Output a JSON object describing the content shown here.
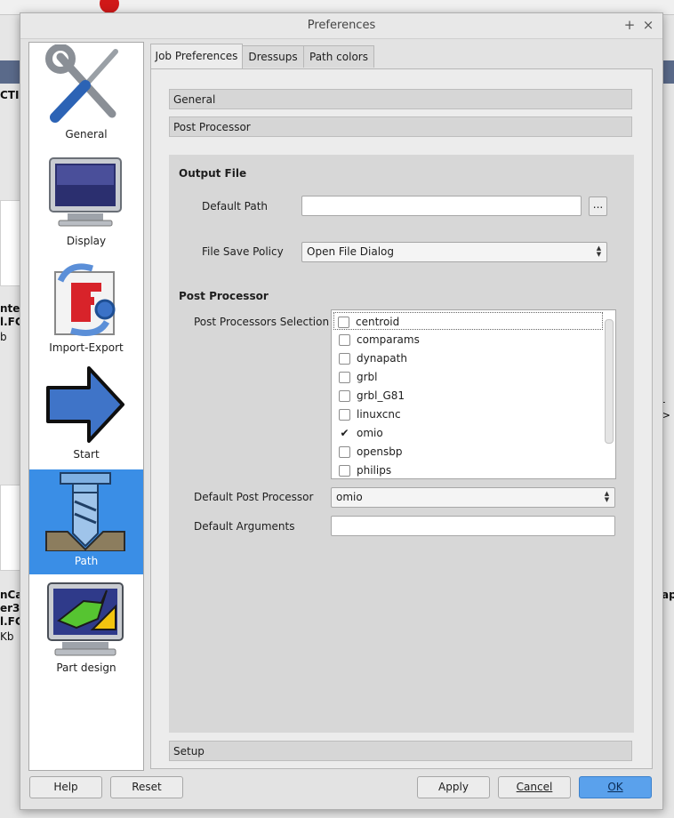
{
  "window": {
    "title": "Preferences",
    "pin_glyph": "+",
    "close_glyph": "×"
  },
  "background": {
    "frag1": "CTI",
    "frag2": "nter",
    "frag3": "l.FC",
    "frag4": "b",
    "frag5": "->",
    "frag6": "nCa",
    "frag7": "er3",
    "frag8": "l.FC",
    "frag9": "Kb",
    "frag10": "ap"
  },
  "pages": [
    {
      "label": "General",
      "icon": "wrench-screwdriver-icon"
    },
    {
      "label": "Display",
      "icon": "monitor-icon"
    },
    {
      "label": "Import-Export",
      "icon": "import-export-icon"
    },
    {
      "label": "Start",
      "icon": "arrow-right-icon"
    },
    {
      "label": "Path",
      "icon": "path-mill-icon",
      "selected": true
    },
    {
      "label": "Part design",
      "icon": "part-design-icon"
    }
  ],
  "tabs": [
    "Job Preferences",
    "Dressups",
    "Path colors"
  ],
  "sections": {
    "general": "General",
    "post_processor": "Post Processor",
    "setup": "Setup"
  },
  "output_file": {
    "heading": "Output File",
    "default_path_label": "Default Path",
    "default_path_value": "",
    "browse_label": "...",
    "save_policy_label": "File Save Policy",
    "save_policy_value": "Open File Dialog"
  },
  "post_processor": {
    "heading": "Post Processor",
    "selection_label": "Post Processors Selection",
    "items": [
      {
        "name": "centroid",
        "checked": false
      },
      {
        "name": "comparams",
        "checked": false
      },
      {
        "name": "dynapath",
        "checked": false
      },
      {
        "name": "grbl",
        "checked": false
      },
      {
        "name": "grbl_G81",
        "checked": false
      },
      {
        "name": "linuxcnc",
        "checked": false
      },
      {
        "name": "omio",
        "checked": true
      },
      {
        "name": "opensbp",
        "checked": false
      },
      {
        "name": "philips",
        "checked": false
      }
    ],
    "default_label": "Default Post Processor",
    "default_value": "omio",
    "args_label": "Default Arguments",
    "args_value": ""
  },
  "footer": {
    "help": "Help",
    "reset": "Reset",
    "apply": "Apply",
    "cancel": "Cancel",
    "ok": "OK"
  },
  "colors": {
    "accent": "#3a8ee6",
    "ok_button": "#5aa1ec"
  }
}
